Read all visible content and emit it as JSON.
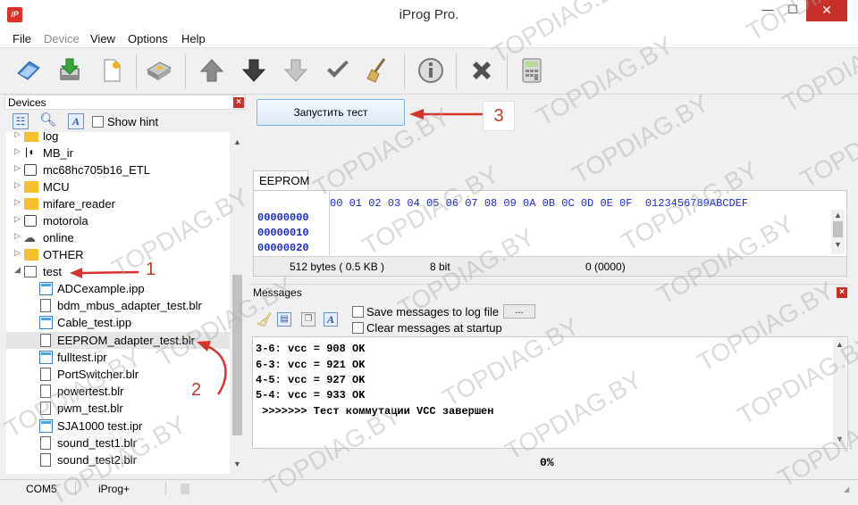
{
  "window": {
    "title": "iProg Pro.",
    "icon_text": "iP",
    "minimize_label": "—",
    "maximize_label": "☐",
    "close_label": "✕"
  },
  "menu": [
    {
      "label": "File",
      "enabled": true
    },
    {
      "label": "Device",
      "enabled": false
    },
    {
      "label": "View",
      "enabled": true
    },
    {
      "label": "Options",
      "enabled": true
    },
    {
      "label": "Help",
      "enabled": true
    }
  ],
  "toolbar": {
    "buttons": [
      "open-icon",
      "save-download-icon",
      "new-document-icon",
      "device-icon",
      "arrow-up-icon",
      "arrow-down-icon",
      "arrow-down-light-icon",
      "checkmark-icon",
      "broom-icon",
      "info-icon",
      "cancel-icon",
      "calculator-icon"
    ]
  },
  "devices": {
    "title": "Devices",
    "show_hint_label": "Show hint",
    "show_hint_checked": false,
    "items": [
      {
        "label": "log",
        "icon": "folder",
        "expanded": false,
        "level": 0
      },
      {
        "label": "MB_ir",
        "icon": "ir-icon",
        "expanded": false,
        "level": 0
      },
      {
        "label": "mc68hc705b16_ETL",
        "icon": "chip",
        "expanded": false,
        "level": 0
      },
      {
        "label": "MCU",
        "icon": "folder",
        "expanded": false,
        "level": 0
      },
      {
        "label": "mifare_reader",
        "icon": "folder",
        "expanded": false,
        "level": 0
      },
      {
        "label": "motorola",
        "icon": "chip",
        "expanded": false,
        "level": 0
      },
      {
        "label": "online",
        "icon": "cloud",
        "expanded": false,
        "level": 0
      },
      {
        "label": "OTHER",
        "icon": "folder",
        "expanded": false,
        "level": 0
      },
      {
        "label": "test",
        "icon": "doc",
        "expanded": true,
        "level": 0
      },
      {
        "label": "ADCexample.ipp",
        "icon": "ipp",
        "level": 1
      },
      {
        "label": "bdm_mbus_adapter_test.blr",
        "icon": "doc",
        "level": 1
      },
      {
        "label": "Cable_test.ipp",
        "icon": "ipp",
        "level": 1
      },
      {
        "label": "EEPROM_adapter_test.blr",
        "icon": "doc",
        "level": 1,
        "selected": true
      },
      {
        "label": "fulltest.ipr",
        "icon": "ipp",
        "level": 1
      },
      {
        "label": "PortSwitcher.blr",
        "icon": "doc",
        "level": 1
      },
      {
        "label": "powertest.blr",
        "icon": "doc",
        "level": 1
      },
      {
        "label": "pwm_test.blr",
        "icon": "doc",
        "level": 1
      },
      {
        "label": "SJA1000 test.ipr",
        "icon": "ipp",
        "level": 1
      },
      {
        "label": "sound_test1.blr",
        "icon": "doc",
        "level": 1
      },
      {
        "label": "sound_test2.blr",
        "icon": "doc",
        "level": 1
      }
    ]
  },
  "run_button_label": "Запустить тест",
  "eeprom": {
    "tab_label": "EEPROM",
    "header": "00 01 02 03 04 05 06 07 08 09 0A 0B 0C 0D 0E 0F  0123456789ABCDEF",
    "rows": [
      "00000000",
      "00000010",
      "00000020"
    ],
    "status_size": "512 bytes ( 0.5 KB )",
    "status_bits": "8 bit",
    "status_offset": "0 (0000)"
  },
  "messages": {
    "title": "Messages",
    "save_log_label": "Save messages to log file",
    "clear_startup_label": "Clear messages at startup",
    "browse_label": "...",
    "lines": [
      "3-6: vcc = 908 OK",
      "6-3: vcc = 921 OK",
      "4-5: vcc = 927 OK",
      "5-4: vcc = 933 OK",
      " >>>>>>> Тест коммутации VCC завершен"
    ],
    "progress_text": "0%"
  },
  "status": {
    "port": "COM5",
    "device": "iProg+"
  },
  "annotations": [
    "1",
    "2",
    "3"
  ],
  "watermark": "TOPDIAG.BY",
  "colors": {
    "accent_red": "#c7302b",
    "hex_blue": "#1a2ad8",
    "folder_yellow": "#f5c02b"
  }
}
